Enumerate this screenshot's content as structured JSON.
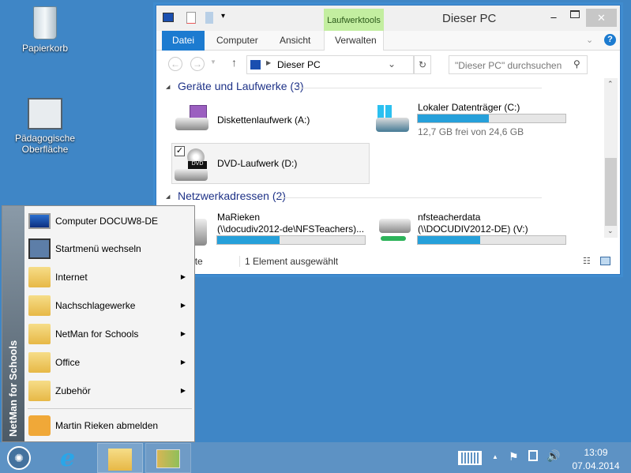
{
  "desktop": {
    "icons": [
      {
        "label": "Papierkorb"
      },
      {
        "label": "Pädagogische Oberfläche"
      }
    ]
  },
  "explorer": {
    "title": "Dieser PC",
    "context_tab": "Laufwerktools",
    "tabs": [
      "Datei",
      "Computer",
      "Ansicht",
      "Verwalten"
    ],
    "address": "Dieser PC",
    "search_placeholder": "\"Dieser PC\" durchsuchen",
    "sections": [
      {
        "title": "Geräte und Laufwerke (3)",
        "items": [
          {
            "name": "Diskettenlaufwerk (A:)",
            "icon": "floppy-drive-icon"
          },
          {
            "name": "Lokaler Datenträger (C:)",
            "icon": "windows-drive-icon",
            "usage_percent": 48,
            "detail": "12,7 GB frei von 24,6 GB"
          },
          {
            "name": "DVD-Laufwerk (D:)",
            "icon": "dvd-drive-icon",
            "selected": true
          }
        ]
      },
      {
        "title": "Netzwerkadressen (2)",
        "items": [
          {
            "name": "MaRieken",
            "path": "(\\\\docudiv2012-de\\NFSTeachers)...",
            "usage_percent": 42,
            "icon": "network-drive-icon"
          },
          {
            "name": "nfsteacherdata",
            "path": "(\\\\DOCUDIV2012-DE) (V:)",
            "usage_percent": 42,
            "icon": "network-drive-icon"
          }
        ]
      }
    ],
    "status": {
      "count": "Elemente",
      "selected": "1 Element ausgewählt"
    }
  },
  "start_menu": {
    "brand": "NetMan for Schools",
    "items": [
      {
        "label": "Computer DOCUW8-DE"
      },
      {
        "label": "Startmenü wechseln"
      },
      {
        "label": "Internet",
        "submenu": true
      },
      {
        "label": "Nachschlagewerke",
        "submenu": true
      },
      {
        "label": "NetMan for Schools",
        "submenu": true
      },
      {
        "label": "Office",
        "submenu": true
      },
      {
        "label": "Zubehör",
        "submenu": true
      }
    ],
    "logoff": "Martin Rieken abmelden"
  },
  "taskbar": {
    "time": "13:09",
    "date": "07.04.2014"
  }
}
